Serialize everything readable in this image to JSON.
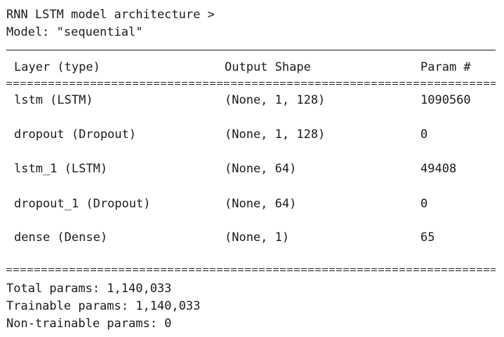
{
  "header": {
    "title": "RNN LSTM model architecture >",
    "model_line": "Model: \"sequential\""
  },
  "table": {
    "columns": [
      "Layer (type)",
      "Output Shape",
      "Param #"
    ],
    "rows": [
      {
        "layer": "lstm (LSTM)",
        "shape": "(None, 1, 128)",
        "params": "1090560"
      },
      {
        "layer": "dropout (Dropout)",
        "shape": "(None, 1, 128)",
        "params": "0"
      },
      {
        "layer": "lstm_1 (LSTM)",
        "shape": "(None, 64)",
        "params": "49408"
      },
      {
        "layer": "dropout_1 (Dropout)",
        "shape": "(None, 64)",
        "params": "0"
      },
      {
        "layer": "dense (Dense)",
        "shape": "(None, 1)",
        "params": "65"
      }
    ]
  },
  "summary": {
    "total": "Total params: 1,140,033",
    "trainable": "Trainable params: 1,140,033",
    "non_trainable": "Non-trainable params: 0"
  }
}
